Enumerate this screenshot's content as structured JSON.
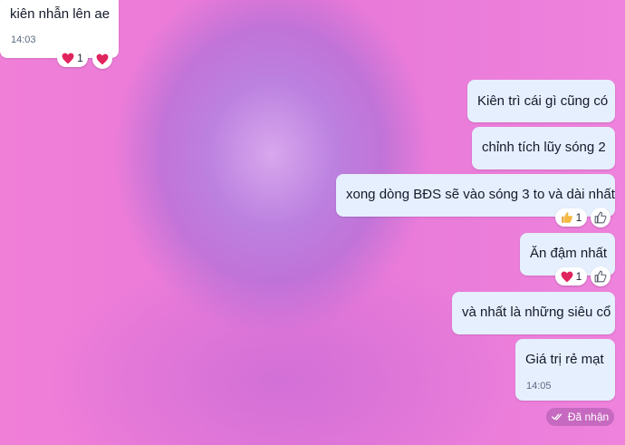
{
  "incoming": {
    "text": "kiên nhẫn lên ae",
    "time": "14:03",
    "reaction_count": "1"
  },
  "outgoing": [
    {
      "text": "Kiên trì cái gì cũng có"
    },
    {
      "text": "chỉnh tích lũy sóng 2"
    },
    {
      "text": "xong dòng BĐS sẽ vào sóng 3 to và dài nhất",
      "reaction_count": "1"
    },
    {
      "text": "Ăn đậm nhất",
      "reaction_count": "1"
    },
    {
      "text": "và nhất là những siêu cổ"
    },
    {
      "text": "Giá trị rẻ mạt",
      "time": "14:05"
    }
  ],
  "status": {
    "label": "Đã nhận"
  },
  "colors": {
    "background": "#ee7ad6",
    "incoming_bubble": "#ffffff",
    "outgoing_bubble": "#e6effd",
    "heart": "#e0245e",
    "thumbs_up": "#f5b942"
  }
}
